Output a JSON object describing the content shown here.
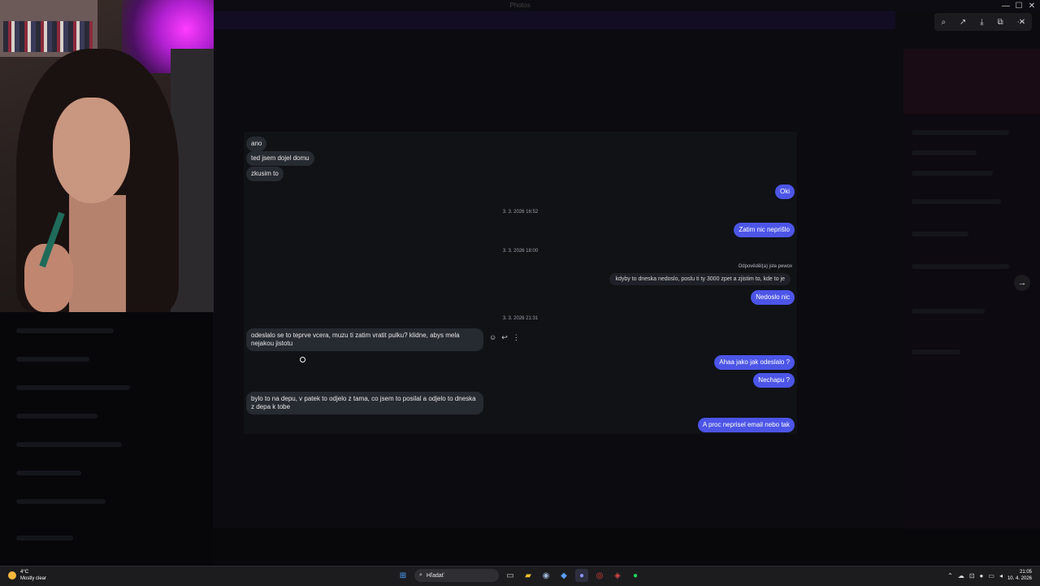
{
  "window": {
    "title": "Photos",
    "controls": {
      "minimize": "—",
      "maximize": "☐",
      "close": "✕"
    }
  },
  "viewer_toolbar": {
    "icons": [
      "zoom-icon",
      "share-icon",
      "download-icon",
      "open-external-icon",
      "more-icon"
    ],
    "close": "✕",
    "next": "→"
  },
  "chat": {
    "messages_top": [
      {
        "dir": "in",
        "text": "ano"
      },
      {
        "dir": "in",
        "text": "ted jsem dojel domu"
      },
      {
        "dir": "in",
        "text": "zkusim to"
      },
      {
        "dir": "out",
        "text": "Oki"
      }
    ],
    "date1": "3. 3. 2026 16:52",
    "msg_zatim": "Zatim nic neprišlo",
    "date2": "3. 3. 2026 18:00",
    "reply_label": "Odpověděl(a) jste pewox",
    "reply_quote": "kdyby to dneska nedoslo, poslu ti ty 3000 zpet a zjistim to, kde to je",
    "msg_nedoslo": "Nedoslo nic",
    "date3": "3. 3. 2026 21:31",
    "msg_odeslalo": "odeslalo se to teprve vcera, muzu ti zatim vratit pulku? klidne, abys mela nejakou jistotu",
    "msg_ahaa": "Ahaa jako jak odeslalo ?",
    "msg_nechapu": "Nechapu ?",
    "msg_depo": "bylo to na depu, v patek to odjelo z tama, co jsem to posilal a odjelo to dneska z depa k tobe",
    "msg_email": "A proc neprisel email nebo tak",
    "actions": {
      "emoji": "☺",
      "reply": "↩",
      "more": "⋮"
    }
  },
  "taskbar": {
    "weather_temp": "4°C",
    "weather_desc": "Mostly clear",
    "search_placeholder": "Hľadať",
    "time": "21:05",
    "date": "10. 4. 2026"
  },
  "colors": {
    "accent_bubble": "#4c55e8",
    "incoming_bubble": "#262a31",
    "chat_bg": "#101216"
  }
}
